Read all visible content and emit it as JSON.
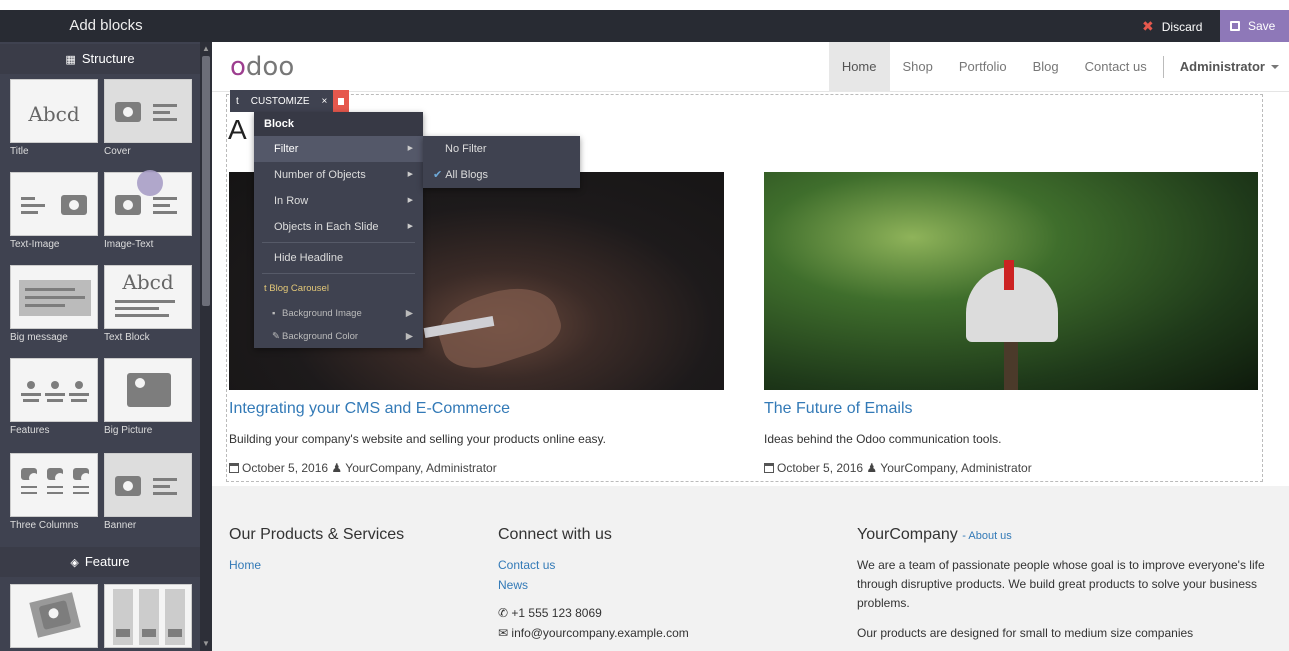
{
  "topbar": {
    "title": "Add blocks",
    "discard": "Discard",
    "save": "Save",
    "discard_color": "#e6584d",
    "save_color": "#8e78b8"
  },
  "sidebar": {
    "structure_label": "Structure",
    "feature_label": "Feature",
    "blocks": {
      "title": "Title",
      "cover": "Cover",
      "text_image": "Text-Image",
      "image_text": "Image-Text",
      "big_message": "Big message",
      "text_block": "Text Block",
      "features": "Features",
      "big_picture": "Big Picture",
      "three_columns": "Three Columns",
      "banner": "Banner",
      "abcd": "Abcd"
    }
  },
  "site": {
    "logo": {
      "o": "o",
      "rest": "doo"
    },
    "nav": {
      "home": "Home",
      "shop": "Shop",
      "portfolio": "Portfolio",
      "blog": "Blog",
      "contact": "Contact us",
      "admin": "Administrator"
    },
    "headline": "A",
    "posts": [
      {
        "title": "Integrating your CMS and E-Commerce",
        "desc": "Building your company's website and selling your products online easy.",
        "date": "October 5, 2016",
        "author": "YourCompany, Administrator"
      },
      {
        "title": "The Future of Emails",
        "desc": "Ideas behind the Odoo communication tools.",
        "date": "October 5, 2016",
        "author": "YourCompany, Administrator"
      }
    ],
    "footer": {
      "col1": {
        "heading": "Our Products & Services",
        "links": [
          "Home"
        ]
      },
      "col2": {
        "heading": "Connect with us",
        "links": [
          "Contact us",
          "News"
        ],
        "phone": "+1 555 123 8069",
        "email": "info@yourcompany.example.com"
      },
      "col3": {
        "heading": "YourCompany",
        "about": "- About us",
        "p1": "We are a team of passionate people whose goal is to improve everyone's life through disruptive products. We build great products to solve your business problems.",
        "p2": "Our products are designed for small to medium size companies"
      }
    }
  },
  "editor": {
    "toolbar": {
      "t": "t",
      "customize": "CUSTOMIZE",
      "close": "×"
    },
    "menu": {
      "header": "Block",
      "items": [
        "Filter",
        "Number of Objects",
        "In Row",
        "Objects in Each Slide",
        "Hide Headline"
      ],
      "section": "Blog Carousel",
      "section_items": [
        "Background Image",
        "Background Color"
      ]
    },
    "submenu": {
      "items": [
        "No Filter",
        "All Blogs"
      ],
      "checked": "All Blogs"
    }
  }
}
